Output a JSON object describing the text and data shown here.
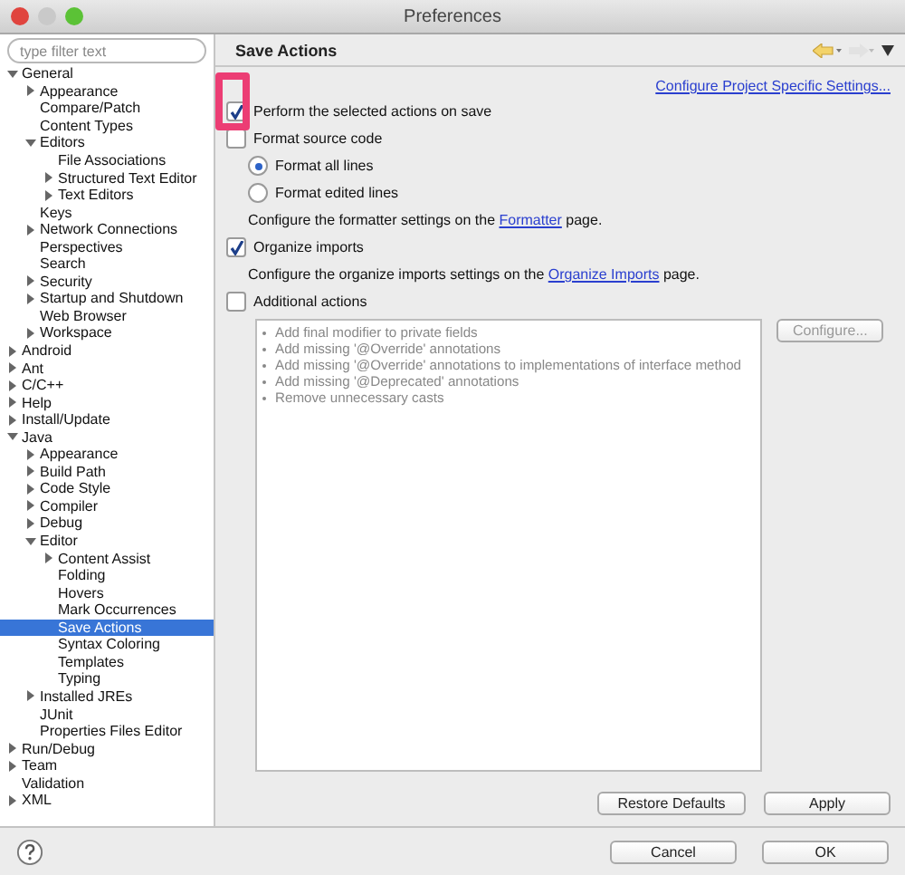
{
  "window": {
    "title": "Preferences"
  },
  "filter": {
    "placeholder": "type filter text"
  },
  "tree": [
    {
      "label": "General",
      "expanded": true,
      "selected": false,
      "children": [
        {
          "label": "Appearance",
          "expanded": false,
          "selected": false
        },
        {
          "label": "Compare/Patch",
          "selected": false
        },
        {
          "label": "Content Types",
          "selected": false
        },
        {
          "label": "Editors",
          "expanded": true,
          "selected": false,
          "children": [
            {
              "label": "File Associations",
              "selected": false
            },
            {
              "label": "Structured Text Editor",
              "expanded": false,
              "selected": false
            },
            {
              "label": "Text Editors",
              "expanded": false,
              "selected": false
            }
          ]
        },
        {
          "label": "Keys",
          "selected": false
        },
        {
          "label": "Network Connections",
          "expanded": false,
          "selected": false
        },
        {
          "label": "Perspectives",
          "selected": false
        },
        {
          "label": "Search",
          "selected": false
        },
        {
          "label": "Security",
          "expanded": false,
          "selected": false
        },
        {
          "label": "Startup and Shutdown",
          "expanded": false,
          "selected": false
        },
        {
          "label": "Web Browser",
          "selected": false
        },
        {
          "label": "Workspace",
          "expanded": false,
          "selected": false
        }
      ]
    },
    {
      "label": "Android",
      "expanded": false,
      "selected": false
    },
    {
      "label": "Ant",
      "expanded": false,
      "selected": false
    },
    {
      "label": "C/C++",
      "expanded": false,
      "selected": false
    },
    {
      "label": "Help",
      "expanded": false,
      "selected": false
    },
    {
      "label": "Install/Update",
      "expanded": false,
      "selected": false
    },
    {
      "label": "Java",
      "expanded": true,
      "selected": false,
      "children": [
        {
          "label": "Appearance",
          "expanded": false,
          "selected": false
        },
        {
          "label": "Build Path",
          "expanded": false,
          "selected": false
        },
        {
          "label": "Code Style",
          "expanded": false,
          "selected": false
        },
        {
          "label": "Compiler",
          "expanded": false,
          "selected": false
        },
        {
          "label": "Debug",
          "expanded": false,
          "selected": false
        },
        {
          "label": "Editor",
          "expanded": true,
          "selected": false,
          "children": [
            {
              "label": "Content Assist",
              "expanded": false,
              "selected": false
            },
            {
              "label": "Folding",
              "selected": false
            },
            {
              "label": "Hovers",
              "selected": false
            },
            {
              "label": "Mark Occurrences",
              "selected": false
            },
            {
              "label": "Save Actions",
              "selected": true
            },
            {
              "label": "Syntax Coloring",
              "selected": false
            },
            {
              "label": "Templates",
              "selected": false
            },
            {
              "label": "Typing",
              "selected": false
            }
          ]
        },
        {
          "label": "Installed JREs",
          "expanded": false,
          "selected": false
        },
        {
          "label": "JUnit",
          "selected": false
        },
        {
          "label": "Properties Files Editor",
          "selected": false
        }
      ]
    },
    {
      "label": "Run/Debug",
      "expanded": false,
      "selected": false
    },
    {
      "label": "Team",
      "expanded": false,
      "selected": false
    },
    {
      "label": "Validation",
      "selected": false
    },
    {
      "label": "XML",
      "expanded": false,
      "selected": false
    }
  ],
  "page": {
    "title": "Save Actions",
    "link": "Configure Project Specific Settings...",
    "options": [
      {
        "kind": "checkbox",
        "label": "Perform the selected actions on save",
        "checked": true,
        "highlighted": true
      },
      {
        "kind": "checkbox",
        "label": "Format source code",
        "checked": false,
        "children": [
          {
            "kind": "radio",
            "label": "Format all lines",
            "selected": true
          },
          {
            "kind": "radio",
            "label": "Format edited lines",
            "selected": false
          },
          {
            "kind": "note",
            "before": "Configure the formatter settings on the ",
            "link": "Formatter",
            "after": " page."
          }
        ]
      },
      {
        "kind": "checkbox",
        "label": "Organize imports",
        "checked": true,
        "children": [
          {
            "kind": "note",
            "before": "Configure the organize imports settings on the ",
            "link": "Organize Imports",
            "after": " page."
          }
        ]
      },
      {
        "kind": "checkbox",
        "label": "Additional actions",
        "checked": false
      }
    ],
    "actions": [
      "Add final modifier to private fields",
      "Add missing '@Override' annotations",
      "Add missing '@Override' annotations to implementations of interface method",
      "Add missing '@Deprecated' annotations",
      "Remove unnecessary casts"
    ],
    "configure": "Configure...",
    "restore": "Restore Defaults",
    "apply": "Apply"
  },
  "footer": {
    "buttons": [
      "Cancel",
      "OK"
    ]
  }
}
